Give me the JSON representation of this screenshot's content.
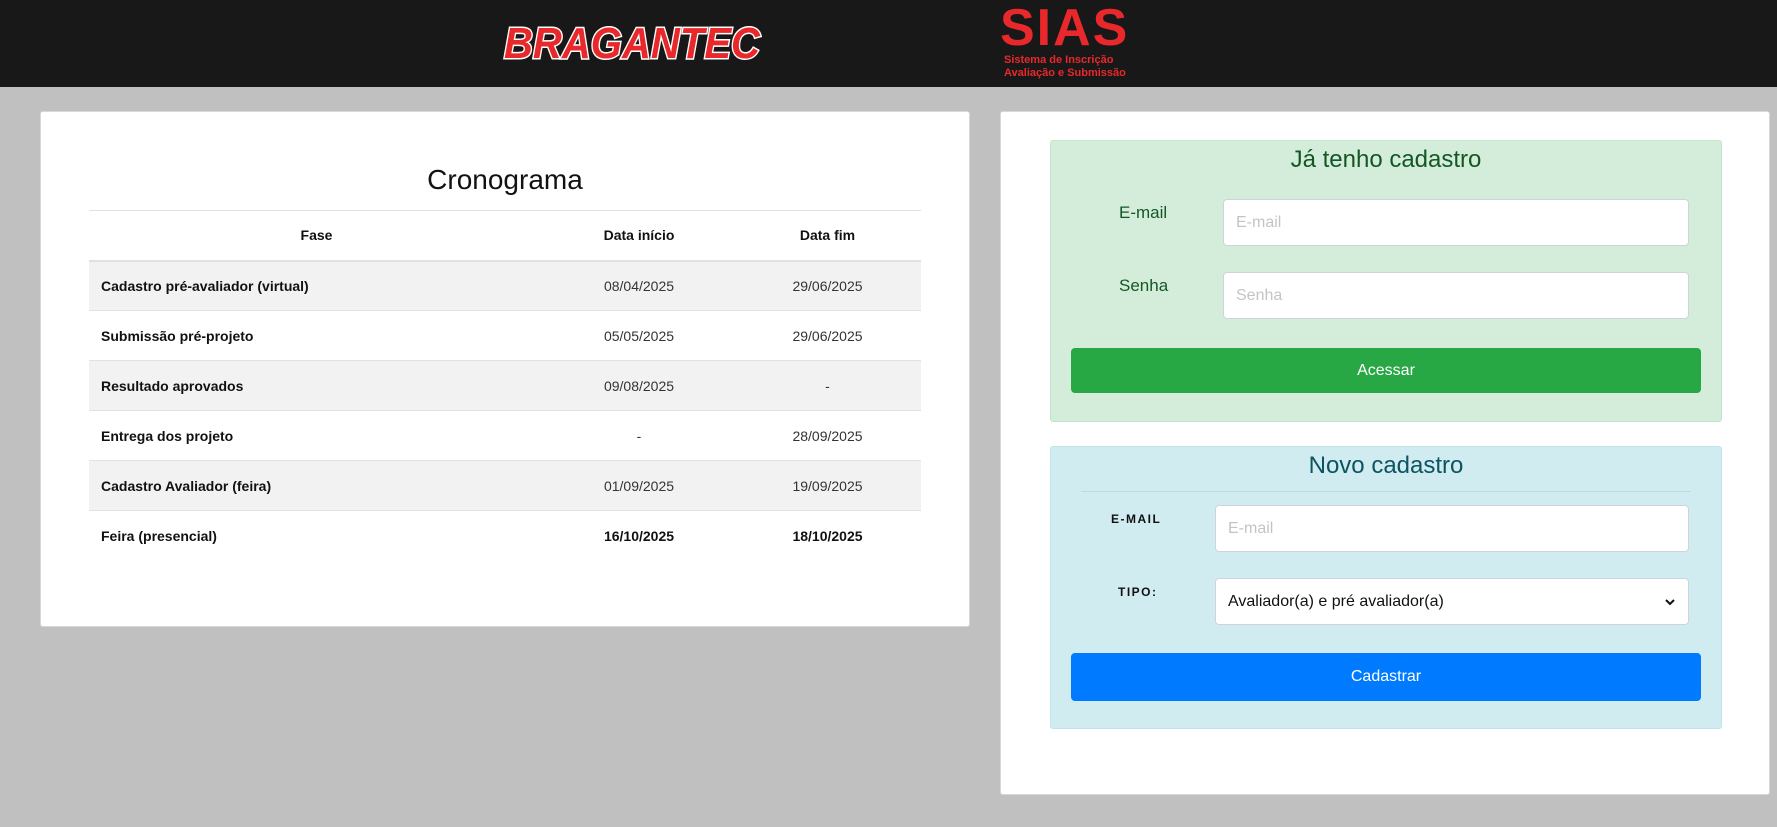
{
  "header": {
    "logo_left": "BRAGANTEC",
    "logo_right_title": "SIAS",
    "logo_right_line1": "Sistema de Inscrição",
    "logo_right_line2": "Avaliação e Submissão"
  },
  "cronograma": {
    "title": "Cronograma",
    "columns": [
      "Fase",
      "Data início",
      "Data fim"
    ],
    "rows": [
      {
        "fase": "Cadastro pré-avaliador (virtual)",
        "inicio": "08/04/2025",
        "fim": "29/06/2025"
      },
      {
        "fase": "Submissão pré-projeto",
        "inicio": "05/05/2025",
        "fim": "29/06/2025"
      },
      {
        "fase": "Resultado aprovados",
        "inicio": "09/08/2025",
        "fim": "-"
      },
      {
        "fase": "Entrega dos projeto",
        "inicio": "-",
        "fim": "28/09/2025"
      },
      {
        "fase": "Cadastro Avaliador (feira)",
        "inicio": "01/09/2025",
        "fim": "19/09/2025"
      },
      {
        "fase": "Feira (presencial)",
        "inicio": "16/10/2025",
        "fim": "18/10/2025"
      }
    ]
  },
  "login": {
    "title": "Já tenho cadastro",
    "email_label": "E-mail",
    "email_placeholder": "E-mail",
    "password_label": "Senha",
    "password_placeholder": "Senha",
    "submit_label": "Acessar"
  },
  "register": {
    "title": "Novo cadastro",
    "email_label": "E-MAIL",
    "email_placeholder": "E-mail",
    "type_label": "TIPO:",
    "type_selected": "Avaliador(a) e pré avaliador(a)",
    "submit_label": "Cadastrar"
  },
  "colors": {
    "header_bg": "#181818",
    "brand_red": "#e8282b",
    "login_bg": "#d4edda",
    "register_bg": "#d1ecf1",
    "btn_green": "#28a745",
    "btn_blue": "#007bff"
  }
}
